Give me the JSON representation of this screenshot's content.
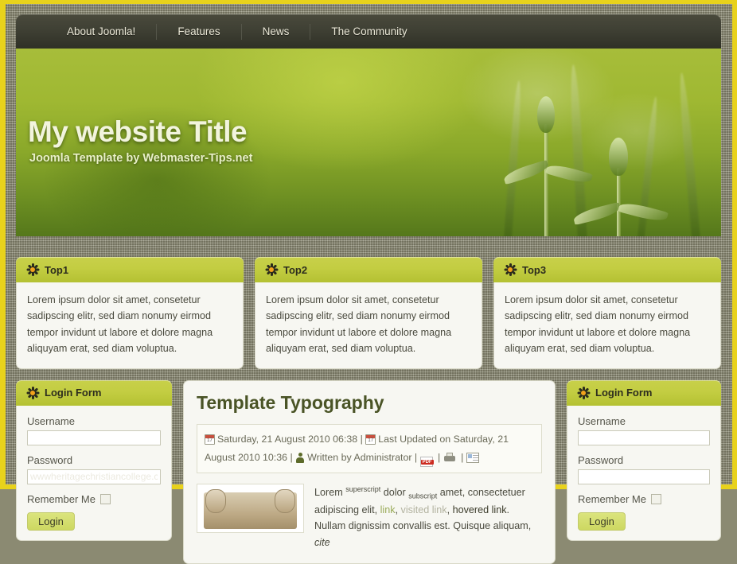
{
  "frame": {
    "border_color": "#e8d21c",
    "background_color": "#8d8c74"
  },
  "nav": {
    "items": [
      {
        "label": "About Joomla!"
      },
      {
        "label": "Features"
      },
      {
        "label": "News"
      },
      {
        "label": "The Community"
      }
    ]
  },
  "header": {
    "title": "My website Title",
    "subtitle": "Joomla Template by Webmaster-Tips.net",
    "image_alt": "green-grass-plants-banner"
  },
  "top_modules": [
    {
      "icon": "starburst-icon",
      "title": "Top1",
      "body": "Lorem ipsum dolor sit amet, consetetur sadipscing elitr, sed diam nonumy eirmod tempor invidunt ut labore et dolore magna aliquyam erat, sed diam voluptua."
    },
    {
      "icon": "starburst-icon",
      "title": "Top2",
      "body": "Lorem ipsum dolor sit amet, consetetur sadipscing elitr, sed diam nonumy eirmod tempor invidunt ut labore et dolore magna aliquyam erat, sed diam voluptua."
    },
    {
      "icon": "starburst-icon",
      "title": "Top3",
      "body": "Lorem ipsum dolor sit amet, consetetur sadipscing elitr, sed diam nonumy eirmod tempor invidunt ut labore et dolore magna aliquyam erat, sed diam voluptua."
    }
  ],
  "login_left": {
    "title": "Login Form",
    "icon": "starburst-icon",
    "username_label": "Username",
    "username_value": "",
    "password_label": "Password",
    "password_value": "wwwheritagechristiancollege.com",
    "remember_label": "Remember Me",
    "remember_checked": false,
    "login_button": "Login"
  },
  "login_right": {
    "title": "Login Form",
    "icon": "starburst-icon",
    "username_label": "Username",
    "username_value": "",
    "password_label": "Password",
    "password_value": "",
    "remember_label": "Remember Me",
    "remember_checked": false,
    "login_button": "Login"
  },
  "article": {
    "title": "Template Typography",
    "created_date": "Saturday, 21 August 2010 06:38",
    "separator": "|",
    "updated_text": "Last Updated on Saturday, 21 August 2010 10:36",
    "author_text": "Written by Administrator",
    "calendar_day": "17",
    "pdf_label": "PDF",
    "actions": [
      "pdf-icon",
      "print-icon",
      "email-icon"
    ],
    "body_parts": {
      "p1": "Lorem ",
      "sup": "superscript",
      "p2": " dolor ",
      "sub": "subscript",
      "p3": " amet, consectetuer adipiscing elit, ",
      "link": "link",
      "p4": ", ",
      "visited": "visited link",
      "p5": ", ",
      "hovered": "hovered link",
      "p6": ". Nullam dignissim convallis est. Quisque aliquam, ",
      "cite": "cite"
    },
    "thumb_alt": "ancient-scroll-image"
  }
}
